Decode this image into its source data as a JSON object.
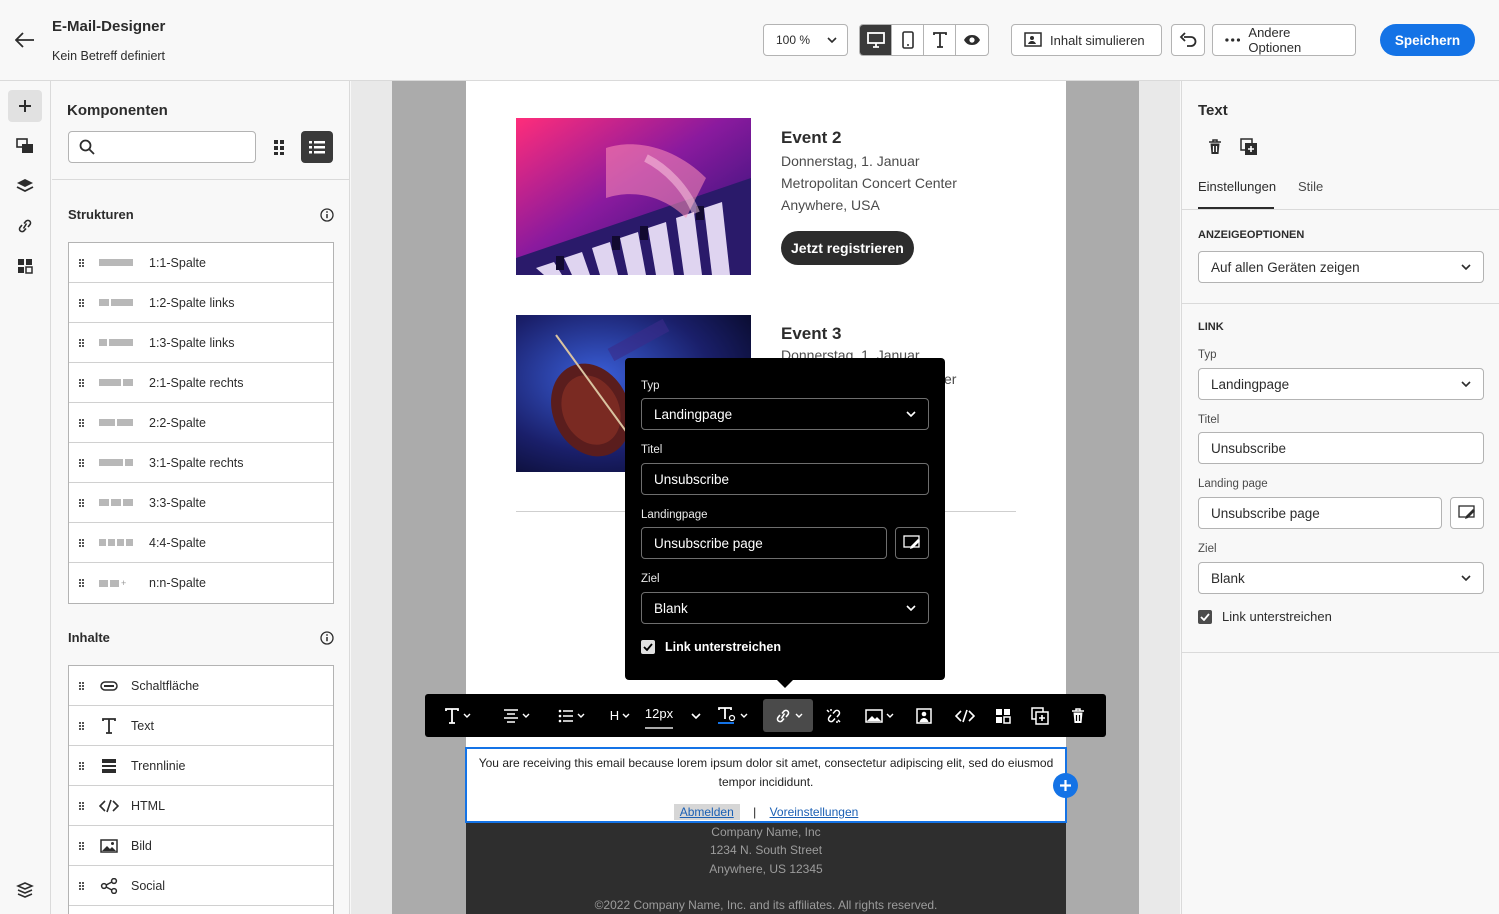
{
  "header": {
    "title": "E-Mail-Designer",
    "subtitle": "Kein Betreff definiert",
    "zoom": "100 %",
    "simulate_label": "Inhalt simulieren",
    "other_options_label": "Andere Optionen",
    "save_label": "Speichern"
  },
  "left_panel": {
    "title": "Komponenten",
    "search_placeholder": "",
    "structures_heading": "Strukturen",
    "structures": [
      {
        "label": "1:1-Spalte"
      },
      {
        "label": "1:2-Spalte links"
      },
      {
        "label": "1:3-Spalte links"
      },
      {
        "label": "2:1-Spalte rechts"
      },
      {
        "label": "2:2-Spalte"
      },
      {
        "label": "3:1-Spalte rechts"
      },
      {
        "label": "3:3-Spalte"
      },
      {
        "label": "4:4-Spalte"
      },
      {
        "label": "n:n-Spalte"
      }
    ],
    "contents_heading": "Inhalte",
    "contents": [
      {
        "label": "Schaltfläche",
        "icon": "button-icon"
      },
      {
        "label": "Text",
        "icon": "text-icon"
      },
      {
        "label": "Trennlinie",
        "icon": "divider-icon"
      },
      {
        "label": "HTML",
        "icon": "code-icon"
      },
      {
        "label": "Bild",
        "icon": "image-icon"
      },
      {
        "label": "Social",
        "icon": "share-icon"
      }
    ]
  },
  "email": {
    "event2": {
      "title": "Event 2",
      "date": "Donnerstag, 1. Januar",
      "venue": "Metropolitan Concert Center",
      "location": "Anywhere, USA",
      "button": "Jetzt registrieren"
    },
    "event3": {
      "title": "Event 3",
      "date": "Donnerstag, 1. Januar",
      "venue_suffix": "er"
    },
    "text_block": {
      "body": "You are receiving this email because lorem ipsum dolor sit amet, consectetur adipiscing elit, sed do eiusmod tempor incididunt.",
      "unsubscribe_link": "Abmelden",
      "separator": "|",
      "preferences_link": "Voreinstellungen"
    },
    "footer": {
      "company": "Company Name, Inc",
      "street": "1234 N. South Street",
      "city": "Anywhere, US 12345",
      "copyright": "©2022 Company Name, Inc. and its affiliates. All rights reserved."
    }
  },
  "toolbar": {
    "font_size": "12px",
    "heading": "H"
  },
  "link_popover": {
    "type_label": "Typ",
    "type_value": "Landingpage",
    "title_label": "Titel",
    "title_value": "Unsubscribe",
    "landing_label": "Landingpage",
    "landing_value": "Unsubscribe page",
    "target_label": "Ziel",
    "target_value": "Blank",
    "underline_label": "Link unterstreichen",
    "underline_checked": true
  },
  "right_panel": {
    "title": "Text",
    "tabs": [
      "Einstellungen",
      "Stile"
    ],
    "display_options_heading": "ANZEIGEOPTIONEN",
    "display_options_value": "Auf allen Geräten zeigen",
    "link_heading": "LINK",
    "type_label": "Typ",
    "type_value": "Landingpage",
    "title_label": "Titel",
    "title_value": "Unsubscribe",
    "landing_label": "Landing page",
    "landing_value": "Unsubscribe page",
    "target_label": "Ziel",
    "target_value": "Blank",
    "underline_label": "Link unterstreichen",
    "underline_checked": true
  },
  "colors": {
    "accent": "#1473e6",
    "dark": "#2c2c2c"
  }
}
